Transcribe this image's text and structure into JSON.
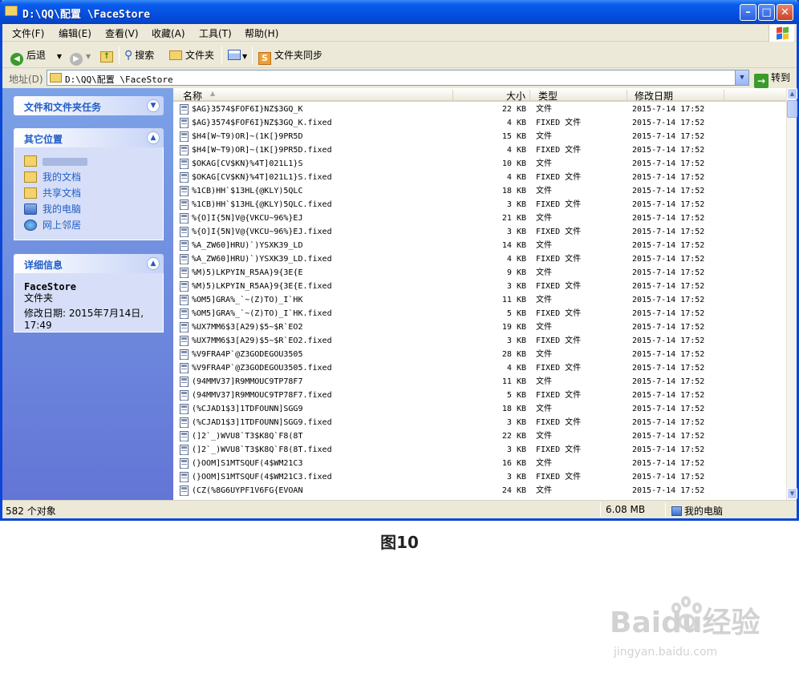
{
  "window": {
    "title": "D:\\QQ\\配置                \\FaceStore",
    "min_glyph": "–",
    "max_glyph": "□",
    "close_glyph": "✕"
  },
  "menu": [
    "文件(F)",
    "编辑(E)",
    "查看(V)",
    "收藏(A)",
    "工具(T)",
    "帮助(H)"
  ],
  "toolbar": {
    "back": "后退",
    "search": "搜索",
    "folders": "文件夹",
    "sync": "文件夹同步"
  },
  "address": {
    "label": "地址(D)",
    "value": "D:\\QQ\\配置           \\FaceStore",
    "go": "转到"
  },
  "tasks": {
    "file_tasks_title": "文件和文件夹任务",
    "other_places_title": "其它位置",
    "places": [
      "",
      "我的文档",
      "共享文档",
      "我的电脑",
      "网上邻居"
    ],
    "details_title": "详细信息",
    "detail_name": "FaceStore",
    "detail_type": "文件夹",
    "detail_modified": "修改日期: 2015年7月14日, 17:49"
  },
  "columns": {
    "name": "名称",
    "size": "大小",
    "type": "类型",
    "modified": "修改日期"
  },
  "files": [
    {
      "name": "$AG}3574$FOF6I}NZ$3GQ_K",
      "size": "22 KB",
      "type": "文件",
      "modified": "2015-7-14 17:52"
    },
    {
      "name": "$AG}3574$FOF6I}NZ$3GQ_K.fixed",
      "size": "4 KB",
      "type": "FIXED 文件",
      "modified": "2015-7-14 17:52"
    },
    {
      "name": "$H4[W~T9)OR]~(1K[}9PR5D",
      "size": "15 KB",
      "type": "文件",
      "modified": "2015-7-14 17:52"
    },
    {
      "name": "$H4[W~T9)OR]~(1K[}9PR5D.fixed",
      "size": "4 KB",
      "type": "FIXED 文件",
      "modified": "2015-7-14 17:52"
    },
    {
      "name": "$OKAG[CV$KN}%4T]021L1}S",
      "size": "10 KB",
      "type": "文件",
      "modified": "2015-7-14 17:52"
    },
    {
      "name": "$OKAG[CV$KN}%4T]021L1}S.fixed",
      "size": "4 KB",
      "type": "FIXED 文件",
      "modified": "2015-7-14 17:52"
    },
    {
      "name": "%1CB)HH`$13HL{@KLY)5QLC",
      "size": "18 KB",
      "type": "文件",
      "modified": "2015-7-14 17:52"
    },
    {
      "name": "%1CB)HH`$13HL{@KLY)5QLC.fixed",
      "size": "3 KB",
      "type": "FIXED 文件",
      "modified": "2015-7-14 17:52"
    },
    {
      "name": "%{O]I{5N]V@{VKCU~96%}EJ",
      "size": "21 KB",
      "type": "文件",
      "modified": "2015-7-14 17:52"
    },
    {
      "name": "%{O]I{5N]V@{VKCU~96%}EJ.fixed",
      "size": "3 KB",
      "type": "FIXED 文件",
      "modified": "2015-7-14 17:52"
    },
    {
      "name": "%A_ZW60]HRU)`)YSXK39_LD",
      "size": "14 KB",
      "type": "文件",
      "modified": "2015-7-14 17:52"
    },
    {
      "name": "%A_ZW60]HRU)`)YSXK39_LD.fixed",
      "size": "4 KB",
      "type": "FIXED 文件",
      "modified": "2015-7-14 17:52"
    },
    {
      "name": "%M)5)LKPYIN_R5AA}9{3E{E",
      "size": "9 KB",
      "type": "文件",
      "modified": "2015-7-14 17:52"
    },
    {
      "name": "%M)5)LKPYIN_R5AA}9{3E{E.fixed",
      "size": "3 KB",
      "type": "FIXED 文件",
      "modified": "2015-7-14 17:52"
    },
    {
      "name": "%OM5]GRA%_`~(Z)TO)_I`HK",
      "size": "11 KB",
      "type": "文件",
      "modified": "2015-7-14 17:52"
    },
    {
      "name": "%OM5]GRA%_`~(Z)TO)_I`HK.fixed",
      "size": "5 KB",
      "type": "FIXED 文件",
      "modified": "2015-7-14 17:52"
    },
    {
      "name": "%UX7MM6$3[A29)$5~$R`EO2",
      "size": "19 KB",
      "type": "文件",
      "modified": "2015-7-14 17:52"
    },
    {
      "name": "%UX7MM6$3[A29)$5~$R`EO2.fixed",
      "size": "3 KB",
      "type": "FIXED 文件",
      "modified": "2015-7-14 17:52"
    },
    {
      "name": "%V9FRA4P`@Z3GODEGOU3505",
      "size": "28 KB",
      "type": "文件",
      "modified": "2015-7-14 17:52"
    },
    {
      "name": "%V9FRA4P`@Z3GODEGOU3505.fixed",
      "size": "4 KB",
      "type": "FIXED 文件",
      "modified": "2015-7-14 17:52"
    },
    {
      "name": "(94MMV37]R9MMOUC9TP78F7",
      "size": "11 KB",
      "type": "文件",
      "modified": "2015-7-14 17:52"
    },
    {
      "name": "(94MMV37]R9MMOUC9TP78F7.fixed",
      "size": "5 KB",
      "type": "FIXED 文件",
      "modified": "2015-7-14 17:52"
    },
    {
      "name": "(%CJAD1$3]1TDFOUNN]SGG9",
      "size": "18 KB",
      "type": "文件",
      "modified": "2015-7-14 17:52"
    },
    {
      "name": "(%CJAD1$3]1TDFOUNN]SGG9.fixed",
      "size": "3 KB",
      "type": "FIXED 文件",
      "modified": "2015-7-14 17:52"
    },
    {
      "name": "(]2`_)WVU8`T3$K8Q`F8(8T",
      "size": "22 KB",
      "type": "文件",
      "modified": "2015-7-14 17:52"
    },
    {
      "name": "(]2`_)WVU8`T3$K8Q`F8(8T.fixed",
      "size": "3 KB",
      "type": "FIXED 文件",
      "modified": "2015-7-14 17:52"
    },
    {
      "name": "(}OOM]S1MTSQUF(4$WM21C3",
      "size": "16 KB",
      "type": "文件",
      "modified": "2015-7-14 17:52"
    },
    {
      "name": "(}OOM]S1MTSQUF(4$WM21C3.fixed",
      "size": "3 KB",
      "type": "FIXED 文件",
      "modified": "2015-7-14 17:52"
    },
    {
      "name": "(CZ(%8G6UYPF1V6FG{EVOAN",
      "size": "24 KB",
      "type": "文件",
      "modified": "2015-7-14 17:52"
    }
  ],
  "status": {
    "count": "582 个对象",
    "size": "6.08 MB",
    "location": "我的电脑"
  },
  "caption": "图10",
  "watermark": {
    "brand": "Baidu经验",
    "url": "jingyan.baidu.com"
  }
}
